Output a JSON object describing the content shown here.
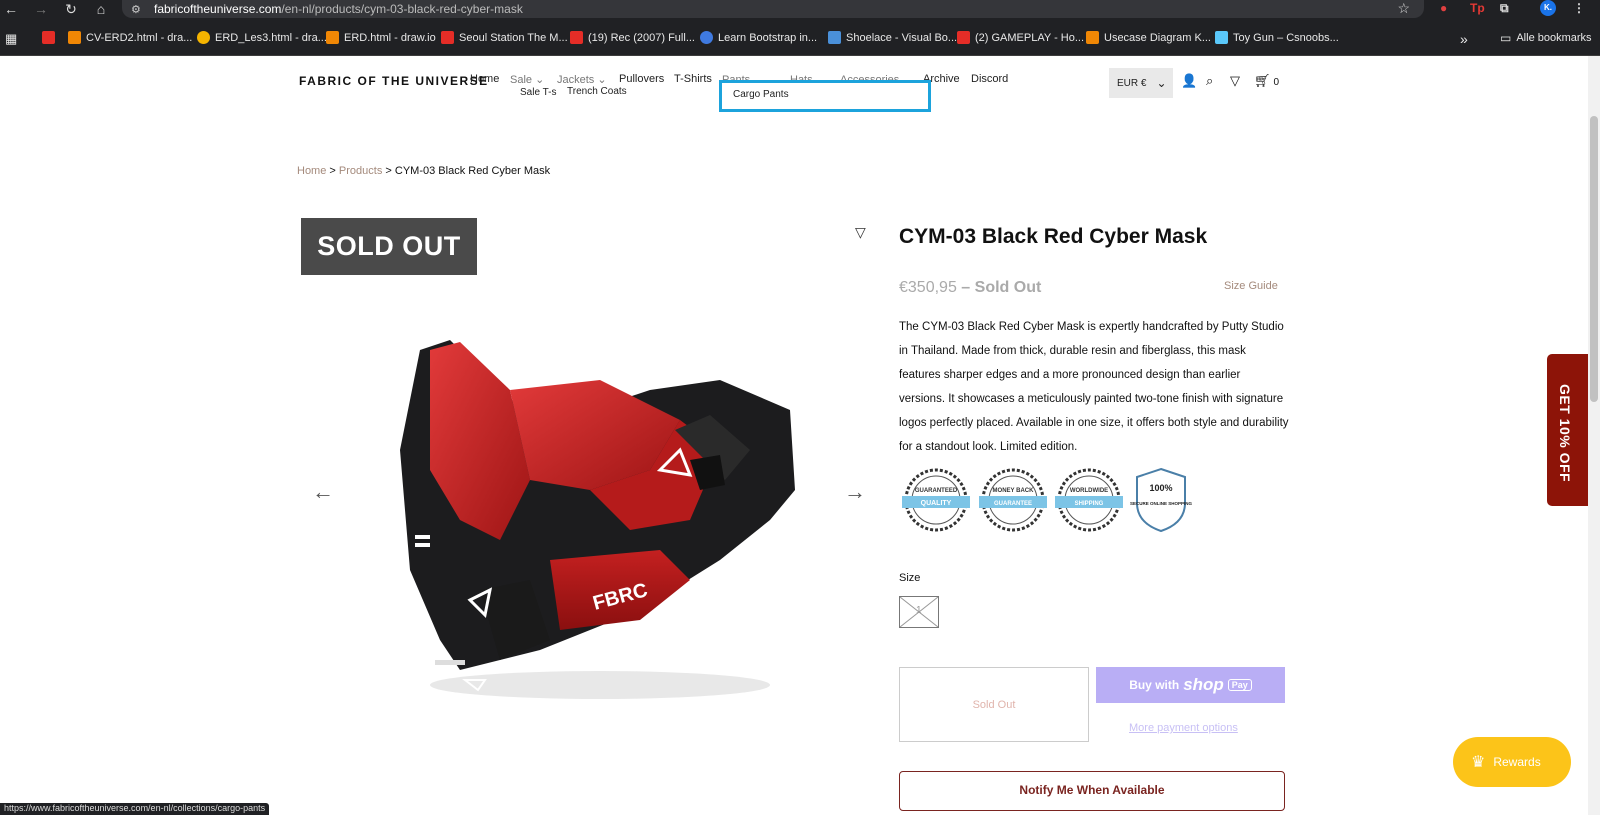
{
  "browser": {
    "url_domain": "fabricoftheuniverse.com",
    "url_path": "/en-nl/products/cym-03-black-red-cyber-mask",
    "bookmarks": [
      "CV-ERD2.html - dra...",
      "ERD_Les3.html - dra...",
      "ERD.html - draw.io",
      "Seoul Station The M...",
      "(19) Rec (2007) Full...",
      "Learn Bootstrap in...",
      "Shoelace - Visual Bo...",
      "(2) GAMEPLAY - Ho...",
      "Usecase Diagram K...",
      "Toy Gun – Csnoobs..."
    ],
    "all_bookmarks": "Alle bookmarks",
    "profile_initial": "K.",
    "status_url": "https://www.fabricoftheuniverse.com/en-nl/collections/cargo-pants"
  },
  "header": {
    "logo": "FABRIC OF THE UNIVERSE",
    "menu": [
      "Home",
      "Sale",
      "Jackets",
      "Pullovers",
      "T-Shirts",
      "Pants",
      "Hats",
      "Accessories",
      "Archive",
      "Discord"
    ],
    "sub_sale": "Sale T-s",
    "sub_jackets": "Trench Coats",
    "sub_highlight": "Cargo Pants",
    "currency": "EUR €",
    "cart_count": "0"
  },
  "breadcrumb": {
    "home": "Home",
    "products": "Products",
    "current": "CYM-03 Black Red Cyber Mask",
    "sep": ">"
  },
  "product": {
    "badge": "SOLD OUT",
    "title": "CYM-03 Black Red Cyber Mask",
    "price": "€350,95",
    "price_status": "– Sold Out",
    "size_guide": "Size Guide",
    "description": "The CYM-03 Black Red Cyber Mask is expertly handcrafted by Putty Studio in Thailand. Made from thick, durable resin and fiberglass, this mask features sharper edges and a more pronounced design than earlier versions. It showcases a meticulously painted two-tone finish with signature logos perfectly placed. Available in one size, it offers both style and durability for a standout look. Limited edition.",
    "size_label": "Size",
    "size_option": "1",
    "sold_out_button": "Sold Out",
    "buy_with": "Buy with",
    "shop_word": "shop",
    "pay_word": "Pay",
    "more_payment": "More payment options",
    "notify": "Notify Me When Available"
  },
  "trust_badges": [
    {
      "top": "GUARANTEED",
      "ribbon": "QUALITY"
    },
    {
      "top": "MONEY BACK",
      "ribbon": "GUARANTEE"
    },
    {
      "top": "WORLDWIDE",
      "ribbon": "SHIPPING"
    },
    {
      "top": "100%",
      "ribbon": "SECURE ONLINE SHOPPING"
    }
  ],
  "promo_tab": "GET 10% OFF",
  "rewards": "Rewards",
  "colors": {
    "accent_brown": "#a48a7c",
    "shop_pay": "#b9aef5",
    "notify_red": "#7a2420",
    "promo_red": "#8d1408",
    "rewards_yellow": "#fcc419",
    "highlight_blue": "#1ca3dc"
  }
}
